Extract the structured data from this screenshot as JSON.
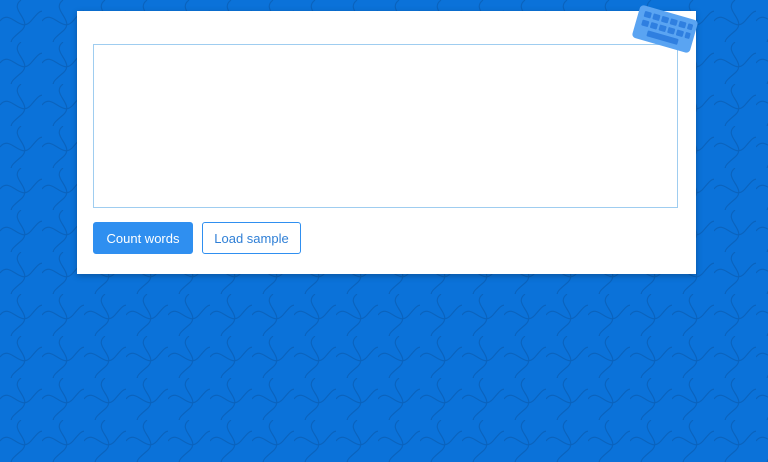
{
  "page": {
    "background_color": "#0b72d9",
    "accent_color": "#2f8ff0"
  },
  "editor": {
    "value": "",
    "placeholder": ""
  },
  "actions": {
    "count_label": "Count words",
    "load_label": "Load sample"
  },
  "icons": {
    "badge": "keyboard-icon"
  }
}
